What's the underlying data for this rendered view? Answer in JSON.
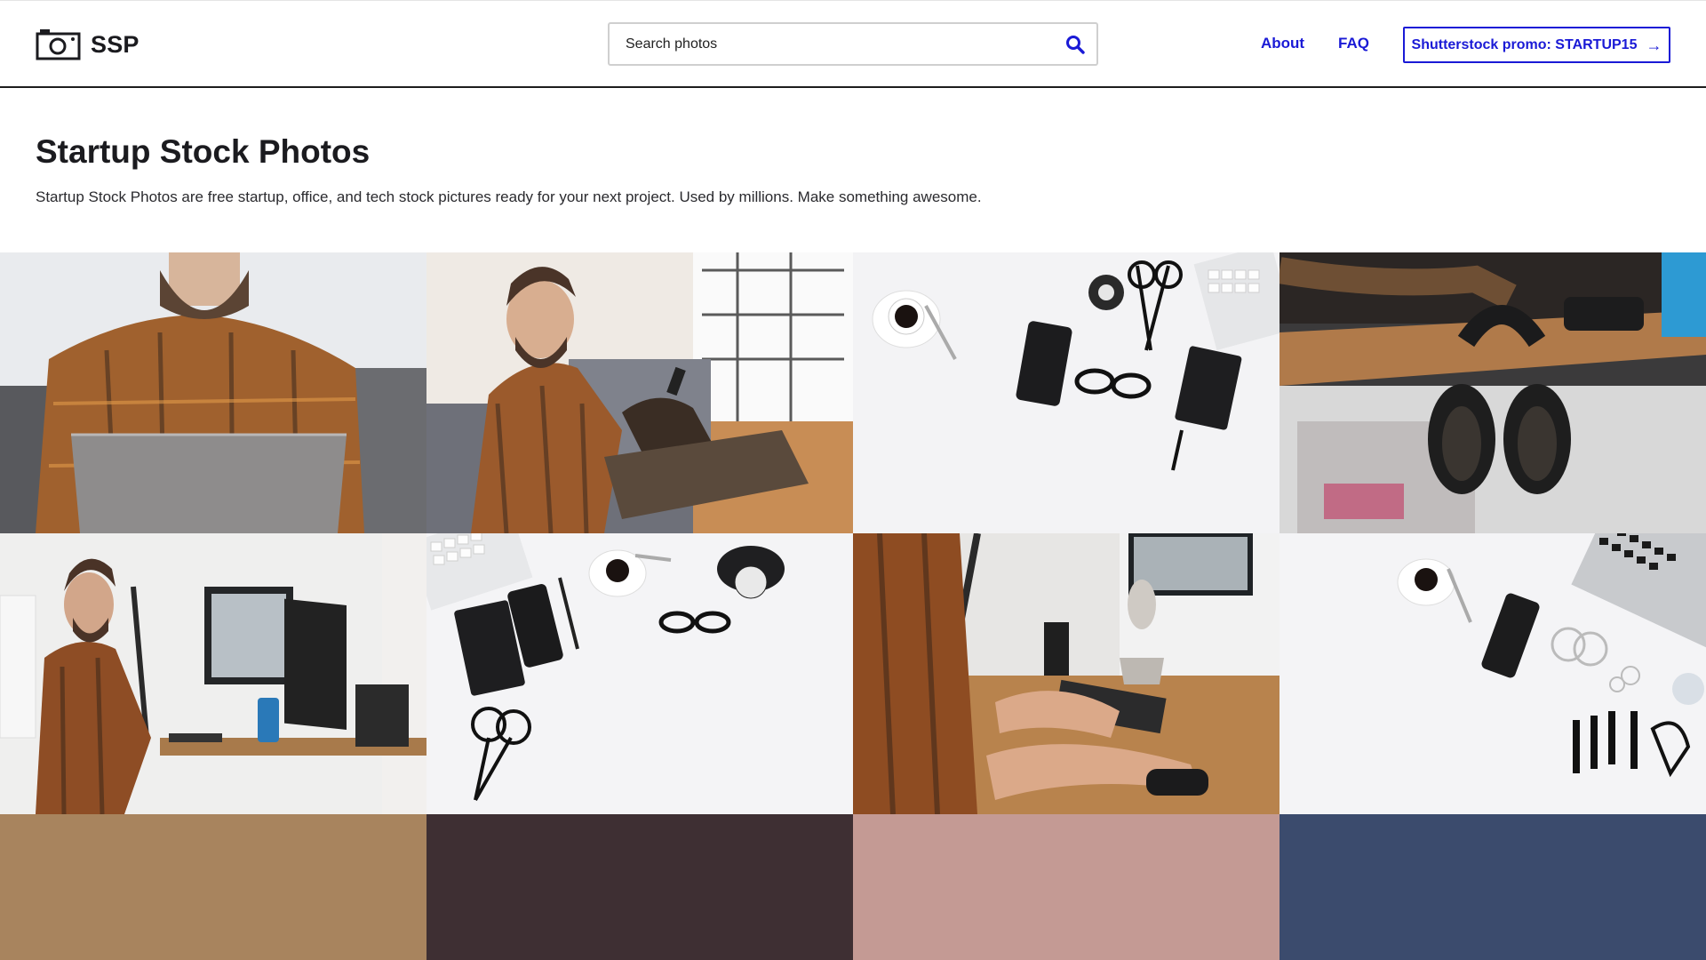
{
  "header": {
    "logo_text": "SSP",
    "search_placeholder": "Search photos",
    "nav": {
      "about": "About",
      "faq": "FAQ"
    },
    "promo_label": "Shutterstock promo: STARTUP15",
    "promo_arrow": "→"
  },
  "intro": {
    "title": "Startup Stock Photos",
    "description": "Startup Stock Photos are free startup, office, and tech stock pictures ready for your next project. Used by millions. Make something awesome."
  },
  "icons": {
    "logo": "camera-icon",
    "search": "search-icon"
  },
  "colors": {
    "accent": "#1a1ad6",
    "text": "#1b1b1f",
    "placeholder_tiles": [
      "#a8845e",
      "#3e2f33",
      "#c49a94",
      "#3b4b6d"
    ]
  }
}
